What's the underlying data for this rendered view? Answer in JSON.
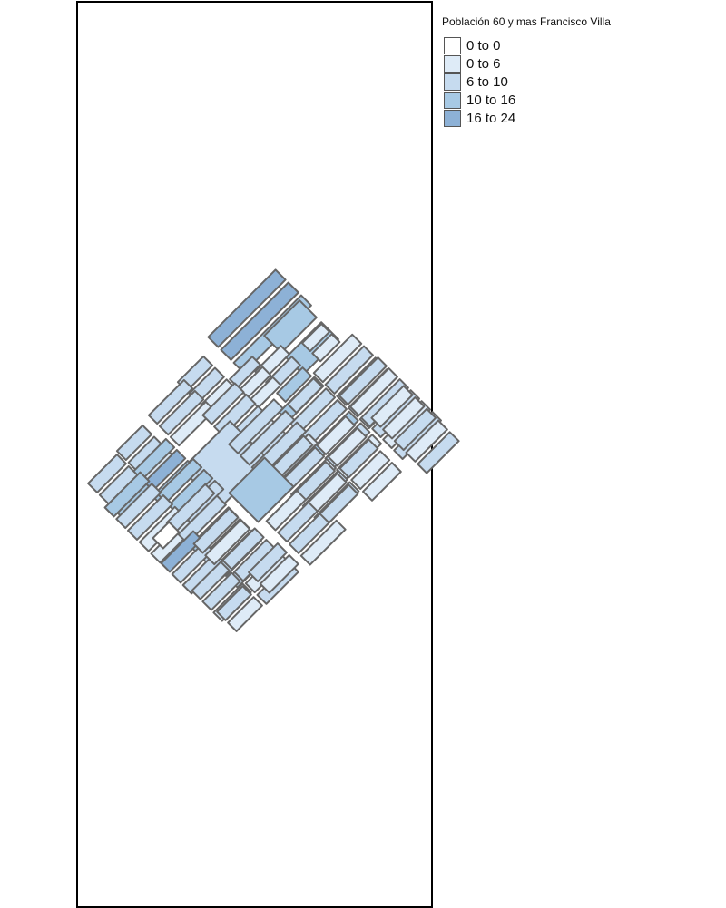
{
  "legend": {
    "title": "Población 60 y mas Francisco Villa",
    "classes": [
      {
        "label": "0 to 0",
        "color": "#ffffff"
      },
      {
        "label": "0 to 6",
        "color": "#deebf7"
      },
      {
        "label": "6 to 10",
        "color": "#c6dbef"
      },
      {
        "label": "10 to 16",
        "color": "#a7c9e4"
      },
      {
        "label": "16 to 24",
        "color": "#8db1d6"
      }
    ]
  },
  "map": {
    "stroke_color": "#666666",
    "frame_color": "#000000"
  }
}
